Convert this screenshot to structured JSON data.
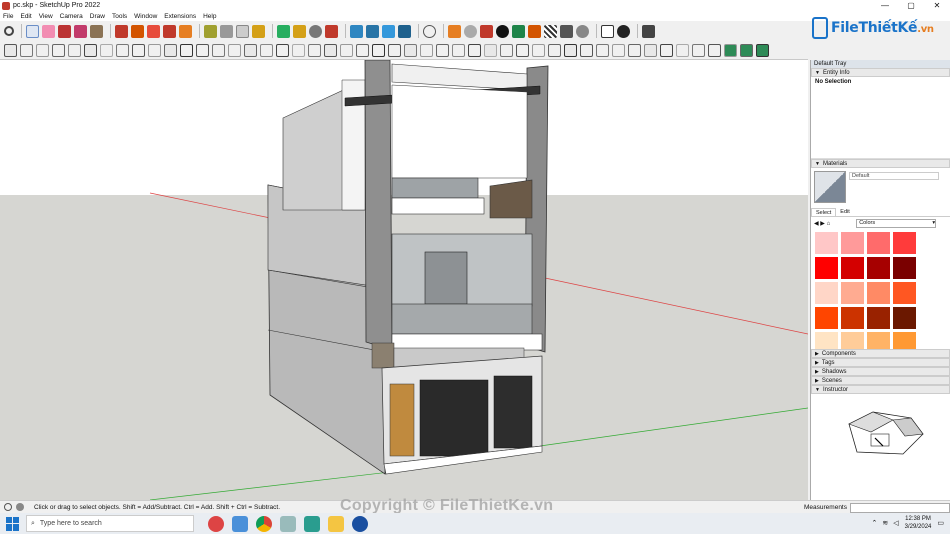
{
  "window": {
    "title": "pc.skp - SketchUp Pro 2022",
    "controls": [
      "—",
      "▢",
      "✕"
    ]
  },
  "menu": [
    "File",
    "Edit",
    "View",
    "Camera",
    "Draw",
    "Tools",
    "Window",
    "Extensions",
    "Help"
  ],
  "logo": {
    "text": "FileThiếtKế",
    "suffix": ".vn"
  },
  "tray": {
    "title": "Default Tray",
    "entity_info": {
      "header": "Entity Info",
      "selection": "No Selection"
    },
    "materials": {
      "header": "Materials",
      "name": "Default",
      "tabs": [
        "Select",
        "Edit"
      ],
      "collection": "Colors",
      "swatches": [
        "#ffc7c7",
        "#ff9a9a",
        "#ff6b6b",
        "#ff3b3b",
        "#ff0000",
        "#d40000",
        "#a60000",
        "#7a0000",
        "#ffd6c7",
        "#ffab91",
        "#ff8a65",
        "#ff5722",
        "#ff4500",
        "#cc3300",
        "#992200",
        "#6b1800",
        "#ffe4c4",
        "#ffcc99",
        "#ffb366",
        "#ff9933"
      ]
    },
    "panels": [
      "Components",
      "Tags",
      "Shadows",
      "Scenes",
      "Instructor"
    ]
  },
  "status": {
    "hint": "Click or drag to select objects. Shift = Add/Subtract. Ctrl = Add. Shift + Ctrl = Subtract.",
    "measurements_label": "Measurements"
  },
  "taskbar": {
    "search_placeholder": "Type here to search",
    "time": "12:38 PM",
    "date": "3/29/2024"
  },
  "watermark": "Copyright © FileThietKe.vn"
}
